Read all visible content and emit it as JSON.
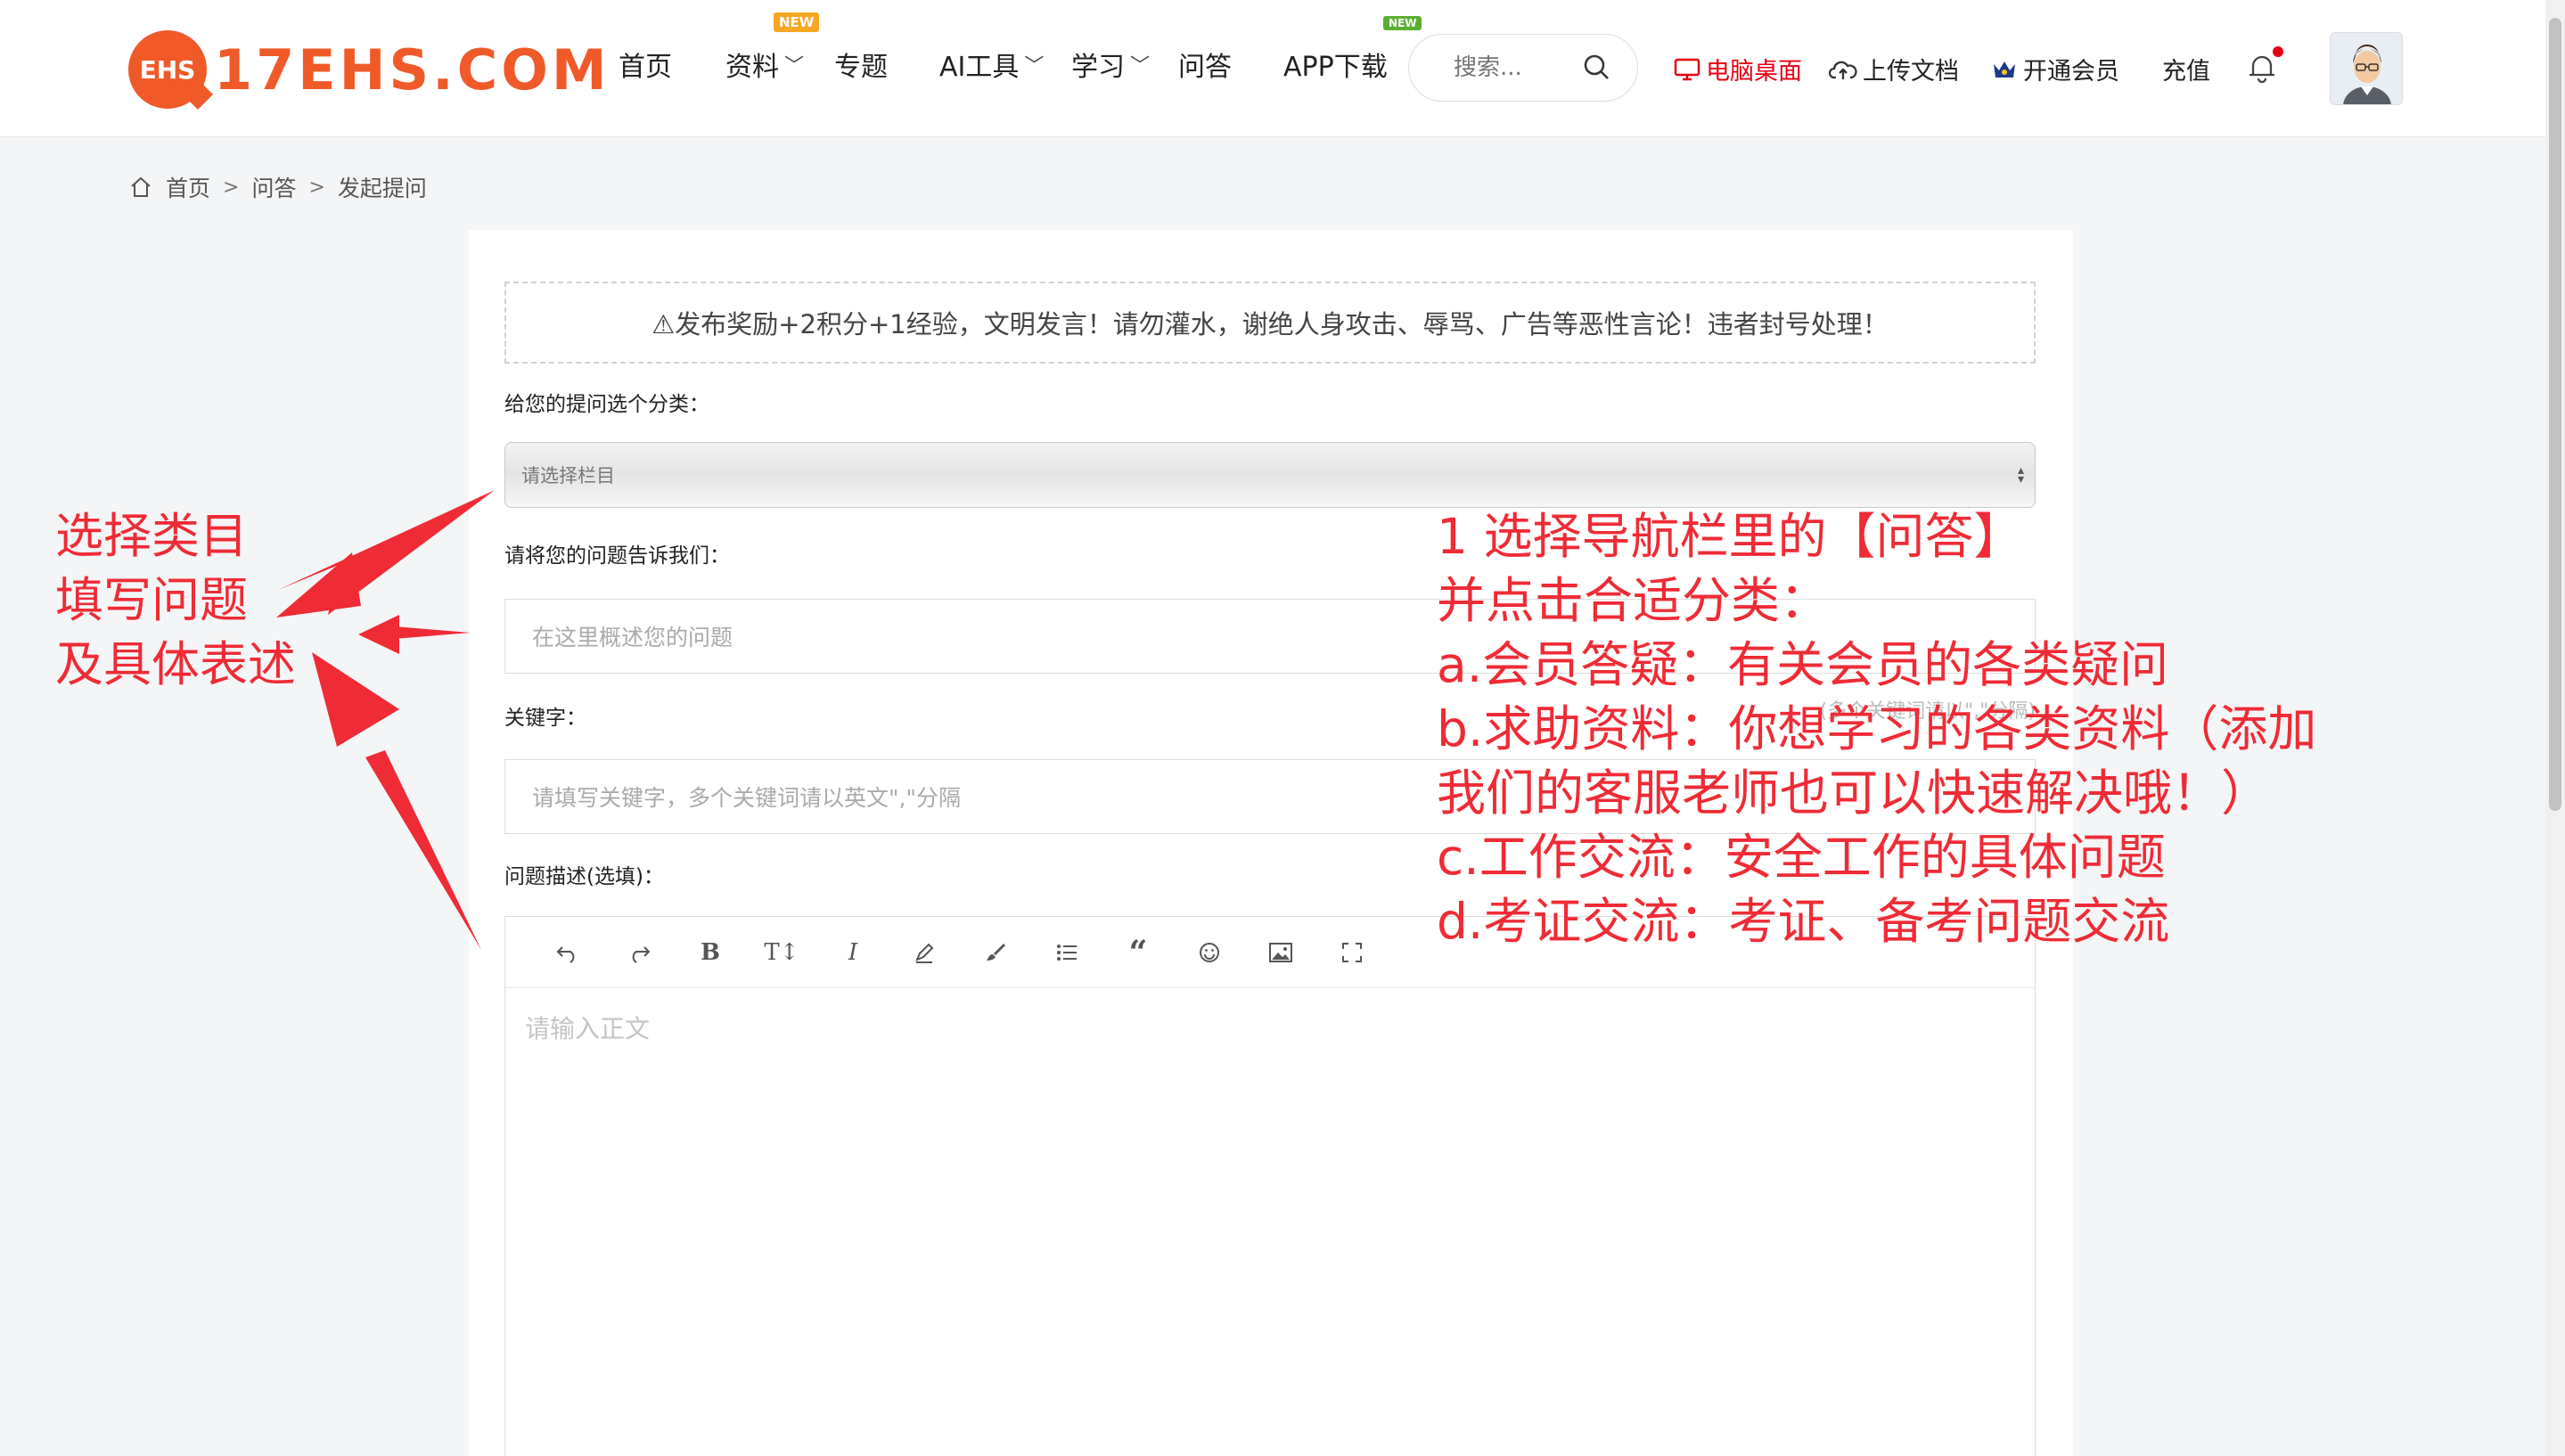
{
  "header": {
    "logo_badge": "EHS",
    "logo_text": "17EHS.COM",
    "nav": [
      {
        "label": "首页"
      },
      {
        "label": "资料",
        "tag": "NEW"
      },
      {
        "label": "专题"
      },
      {
        "label": "AI工具"
      },
      {
        "label": "学习"
      },
      {
        "label": "问答"
      },
      {
        "label": "APP下载",
        "tag": "NEW"
      }
    ],
    "search_placeholder": "搜索...",
    "links": {
      "desktop": "电脑桌面",
      "upload": "上传文档",
      "vip": "开通会员",
      "recharge": "充值"
    }
  },
  "breadcrumb": {
    "home": "首页",
    "qa": "问答",
    "current": "发起提问"
  },
  "form": {
    "notice": "⚠发布奖励+2积分+1经验，文明发言！请勿灌水，谢绝人身攻击、辱骂、广告等恶性言论！违者封号处理！",
    "category_label": "给您的提问选个分类：",
    "category_placeholder": "请选择栏目",
    "question_label": "请将您的问题告诉我们：",
    "question_placeholder": "在这里概述您的问题",
    "keywords_label": "关键字：",
    "keywords_hint": "(多个关键词请以\",\"分隔)",
    "keywords_placeholder": "请填写关键字，多个关键词请以英文\",\"分隔",
    "desc_label": "问题描述(选填)：",
    "editor_placeholder": "请输入正文",
    "toolbar": [
      "undo",
      "redo",
      "bold",
      "text-size",
      "italic",
      "highlighter",
      "brush",
      "list",
      "quote",
      "emoji",
      "image",
      "fullscreen"
    ]
  },
  "annotations": {
    "left": [
      "选择类目",
      "填写问题",
      "及具体表述"
    ],
    "right": [
      "1 选择导航栏里的【问答】",
      "并点击合适分类：",
      "a.会员答疑：有关会员的各类疑问",
      "b.求助资料：你想学习的各类资料（添加",
      "我们的客服老师也可以快速解决哦！）",
      "c.工作交流：安全工作的具体问题",
      "d.考证交流：考证、备考问题交流"
    ],
    "color": "#ef2b35"
  }
}
